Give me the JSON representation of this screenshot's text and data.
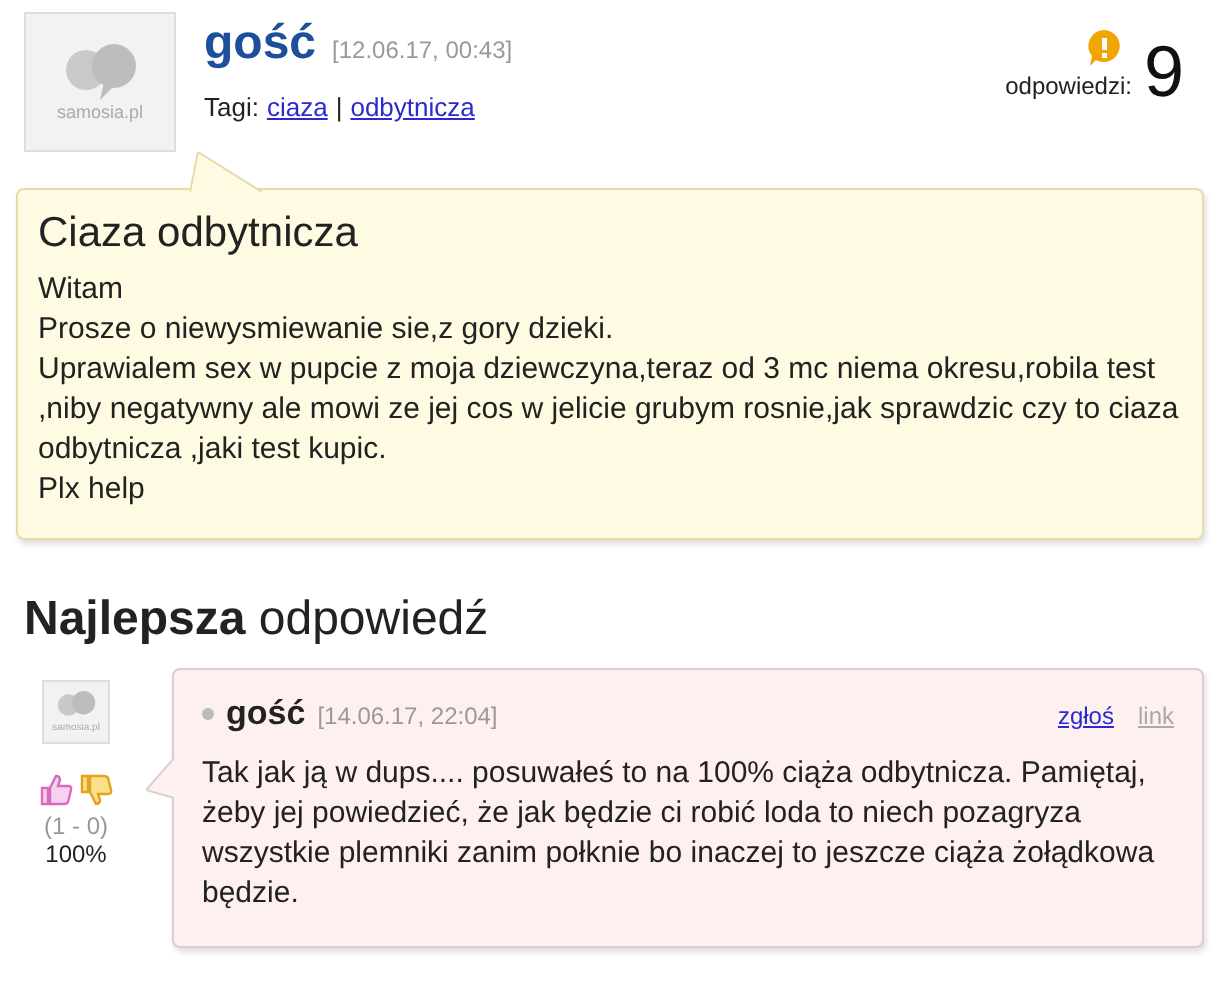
{
  "question": {
    "avatar_label": "samosia.pl",
    "author": "gość",
    "date": "[12.06.17, 00:43]",
    "tags_label": "Tagi:",
    "tags": [
      "ciaza",
      "odbytnicza"
    ],
    "tag_separator": "|",
    "answers_label": "odpowiedzi:",
    "answers_count": "9",
    "title": "Ciaza odbytnicza",
    "paragraphs": [
      "Witam",
      "Prosze o niewysmiewanie sie,z gory dzieki.",
      "Uprawialem sex w pupcie z moja dziewczyna,teraz od 3 mc niema okresu,robila test ,niby negatywny ale mowi ze jej cos w jelicie grubym rosnie,jak sprawdzic czy to ciaza odbytnicza ,jaki test kupic.",
      "Plx help"
    ]
  },
  "best_heading": "**Najlepsza** odpowiedź",
  "answer": {
    "avatar_label": "samosia.pl",
    "votes": "(1 - 0)",
    "percent": "100%",
    "author": "gość",
    "date": "[14.06.17, 22:04]",
    "actions": [
      "zgłoś",
      "link"
    ],
    "text": "Tak jak ją w dups.... posuwałeś to na 100% ciąża odbytnicza. Pamiętaj, żeby jej powiedzieć, że jak będzie ci robić loda to niech pozagryza wszystkie plemniki zanim połknie bo inaczej to jeszcze ciąża żołądkowa będzie."
  }
}
